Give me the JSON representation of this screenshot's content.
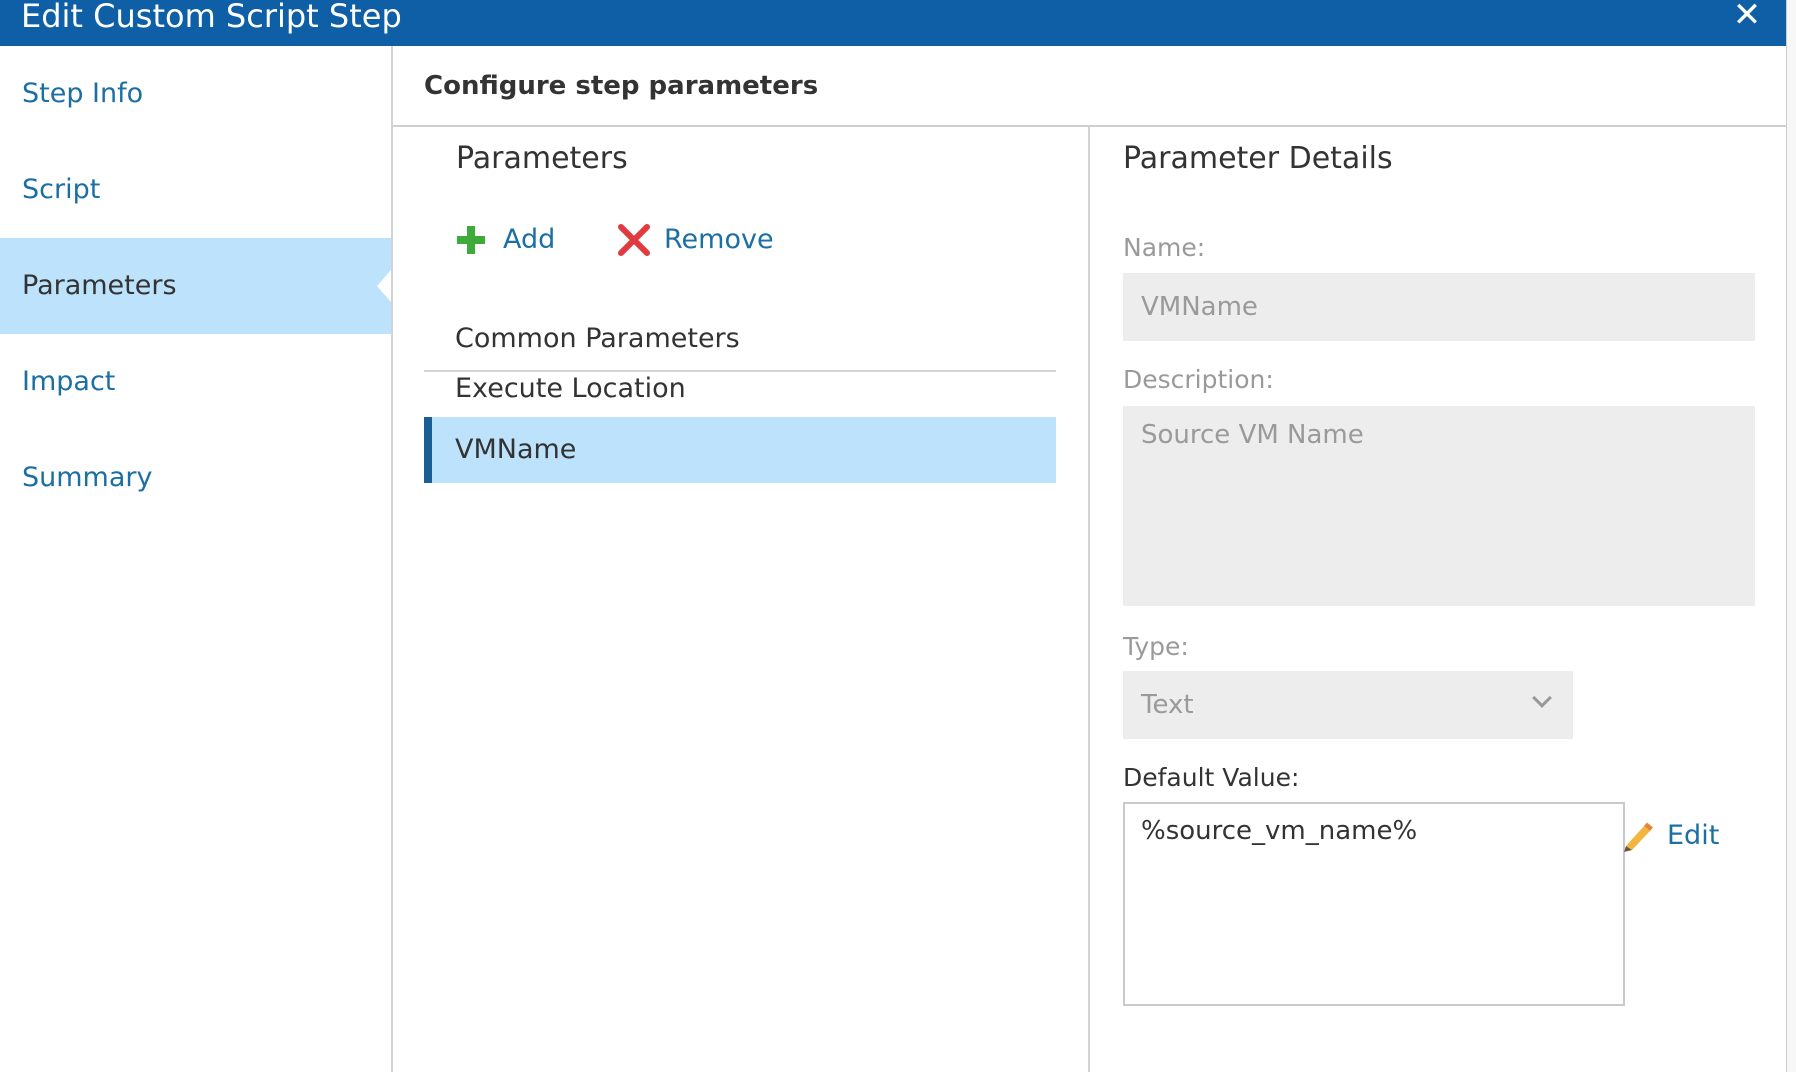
{
  "dialog": {
    "title": "Edit Custom Script Step",
    "close_glyph": "✕"
  },
  "sidebar": {
    "items": [
      {
        "label": "Step Info",
        "active": false
      },
      {
        "label": "Script",
        "active": false
      },
      {
        "label": "Parameters",
        "active": true
      },
      {
        "label": "Impact",
        "active": false
      },
      {
        "label": "Summary",
        "active": false
      }
    ]
  },
  "content": {
    "header": "Configure step parameters"
  },
  "parameters": {
    "title": "Parameters",
    "add_label": "Add",
    "remove_label": "Remove",
    "group_label": "Common Parameters",
    "rows": [
      {
        "label": "Execute Location",
        "selected": false
      },
      {
        "label": "VMName",
        "selected": true
      }
    ]
  },
  "details": {
    "title": "Parameter Details",
    "name_label": "Name:",
    "name_value": "VMName",
    "description_label": "Description:",
    "description_value": "Source VM Name",
    "type_label": "Type:",
    "type_value": "Text",
    "default_label": "Default Value:",
    "default_value": "%source_vm_name%",
    "edit_label": "Edit"
  },
  "colors": {
    "titlebar": "#0e5fa5",
    "link": "#1c6fa3",
    "selected_bg": "#bde2fb",
    "selected_bar": "#1a5e96",
    "add_icon": "#3daa3a",
    "remove_icon": "#e0393e"
  },
  "icons": {
    "close": "close-icon",
    "add": "plus-icon",
    "remove": "x-icon",
    "edit": "pencil-icon",
    "type_dropdown": "chevron-down-icon"
  }
}
